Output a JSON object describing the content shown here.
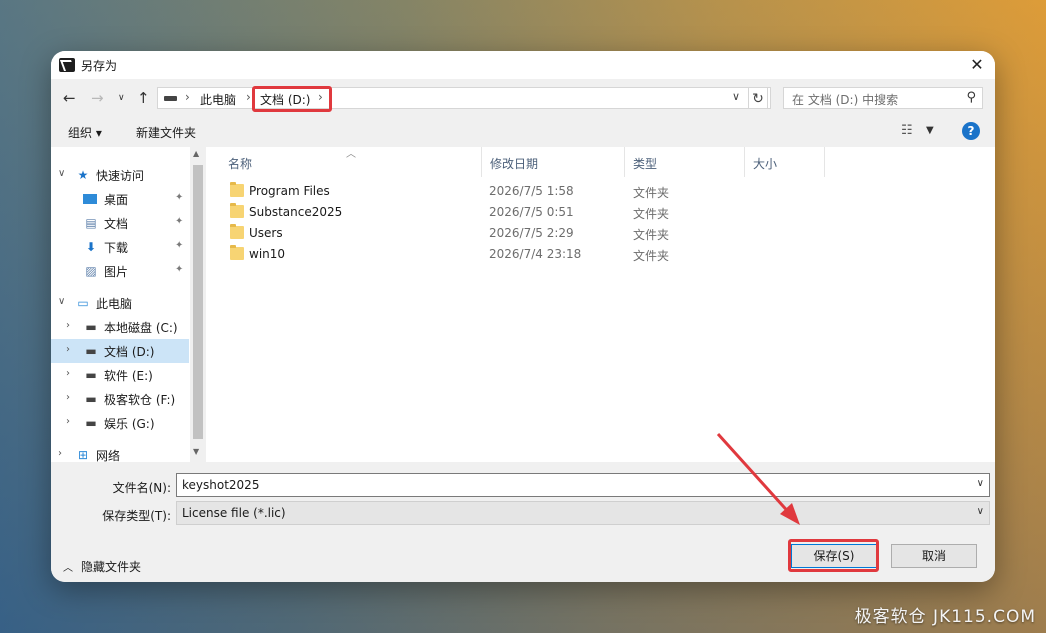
{
  "dialog": {
    "title": "另存为",
    "close_label": "✕"
  },
  "navigation": {
    "back_icon": "arrow-left",
    "forward_icon": "arrow-right",
    "recent_icon": "chevron-down",
    "up_icon": "arrow-up",
    "breadcrumb": [
      "此电脑",
      "文档 (D:)"
    ],
    "search_placeholder": "在 文档 (D:) 中搜索"
  },
  "command_bar": {
    "organize": "组织 ▾",
    "new_folder": "新建文件夹",
    "help": "?"
  },
  "sidebar": {
    "quick_access": "快速访问",
    "quick_items": [
      {
        "label": "桌面",
        "icon": "desktop-icon"
      },
      {
        "label": "文档",
        "icon": "document-icon"
      },
      {
        "label": "下载",
        "icon": "download-icon"
      },
      {
        "label": "图片",
        "icon": "picture-icon"
      }
    ],
    "this_pc": "此电脑",
    "drives": [
      {
        "label": "本地磁盘 (C:)",
        "selected": false
      },
      {
        "label": "文档 (D:)",
        "selected": true
      },
      {
        "label": "软件 (E:)",
        "selected": false
      },
      {
        "label": "极客软仓 (F:)",
        "selected": false
      },
      {
        "label": "娱乐 (G:)",
        "selected": false
      }
    ],
    "network": "网络"
  },
  "file_list": {
    "columns": [
      "名称",
      "修改日期",
      "类型",
      "大小"
    ],
    "rows": [
      {
        "name": "Program Files",
        "modified": "2026/7/5 1:58",
        "type": "文件夹"
      },
      {
        "name": "Substance2025",
        "modified": "2026/7/5 0:51",
        "type": "文件夹"
      },
      {
        "name": "Users",
        "modified": "2026/7/5 2:29",
        "type": "文件夹"
      },
      {
        "name": "win10",
        "modified": "2026/7/4 23:18",
        "type": "文件夹"
      }
    ]
  },
  "form": {
    "filename_label": "文件名(N):",
    "filename_value": "keyshot2025",
    "filetype_label": "保存类型(T):",
    "filetype_value": "License file (*.lic)"
  },
  "footer": {
    "hide_folders": "隐藏文件夹",
    "save": "保存(S)",
    "cancel": "取消"
  },
  "watermark": "极客软仓 JK115.COM",
  "colors": {
    "highlight": "#e0393e",
    "selection": "#cce4f7",
    "accent": "#0078d7"
  }
}
